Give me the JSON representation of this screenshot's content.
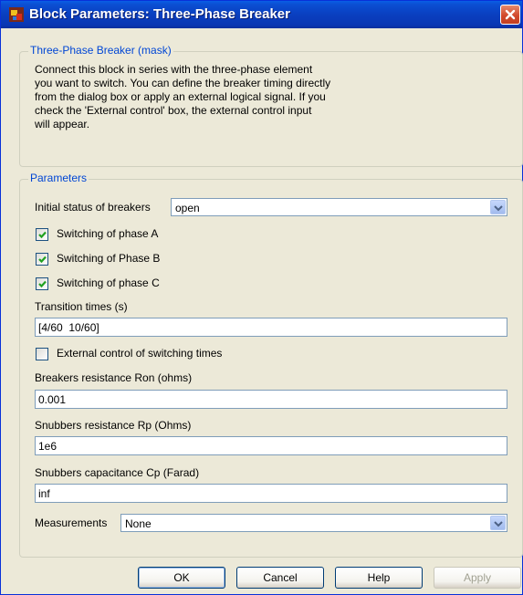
{
  "window": {
    "title": "Block Parameters: Three-Phase Breaker",
    "app_icon": "simulink-block-icon",
    "close_icon": "close-icon"
  },
  "mask": {
    "legend": "Three-Phase Breaker (mask)",
    "description_lines": [
      "Connect this block in series with the three-phase element",
      "you want to switch. You can define the breaker timing directly",
      "from the dialog box or apply an external logical signal. If you",
      "check  the 'External control' box, the external control input",
      "will appear."
    ]
  },
  "params": {
    "legend": "Parameters",
    "initial_status": {
      "label": "Initial status of breakers",
      "value": "open"
    },
    "phase_a": {
      "label": "Switching of phase A",
      "checked": true
    },
    "phase_b": {
      "label": "Switching of Phase B",
      "checked": true
    },
    "phase_c": {
      "label": "Switching of phase C",
      "checked": true
    },
    "transition": {
      "label": "Transition times (s)",
      "value": "[4/60  10/60]"
    },
    "external": {
      "label": "External control of switching times",
      "checked": false
    },
    "ron": {
      "label": "Breakers resistance Ron (ohms)",
      "value": "0.001"
    },
    "rp": {
      "label": "Snubbers resistance Rp (Ohms)",
      "value": "1e6"
    },
    "cp": {
      "label": "Snubbers capacitance Cp (Farad)",
      "value": "inf"
    },
    "measurements": {
      "label": "Measurements",
      "value": "None"
    }
  },
  "buttons": {
    "ok": "OK",
    "cancel": "Cancel",
    "help": "Help",
    "apply": "Apply"
  },
  "colors": {
    "titlebar": "#0a3fc0",
    "legend_text": "#0046d5",
    "dialog_bg": "#ece9d8",
    "checkmark": "#21a121"
  }
}
